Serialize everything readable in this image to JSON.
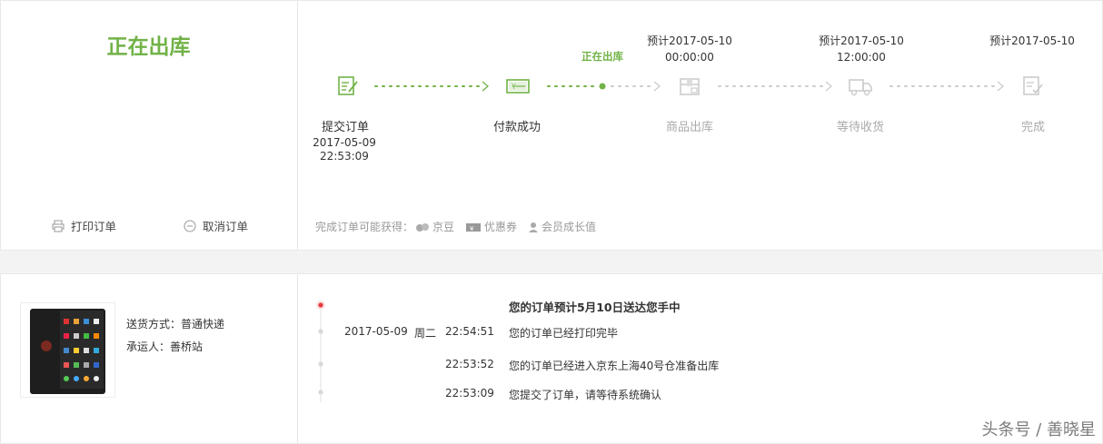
{
  "order_status": {
    "title": "正在出库",
    "actions": [
      {
        "label": "打印订单",
        "icon": "printer-icon"
      },
      {
        "label": "取消订单",
        "icon": "minus-circle-icon"
      }
    ]
  },
  "progress": {
    "current_label": "正在出库",
    "steps": [
      {
        "name": "提交订单",
        "date": "2017-05-09",
        "time": "22:53:09",
        "state": "done",
        "icon": "edit-document-icon"
      },
      {
        "name": "付款成功",
        "date": "",
        "time": "",
        "state": "done",
        "icon": "payment-card-icon"
      },
      {
        "name": "商品出库",
        "eta_date": "预计2017-05-10",
        "eta_time": "00:00:00",
        "state": "pending",
        "icon": "package-box-icon"
      },
      {
        "name": "等待收货",
        "eta_date": "预计2017-05-10",
        "eta_time": "12:00:00",
        "state": "pending",
        "icon": "delivery-truck-icon"
      },
      {
        "name": "完成",
        "eta_date": "预计2017-05-10",
        "state": "pending",
        "icon": "checklist-icon"
      }
    ],
    "colors": {
      "active": "#71b247",
      "inactive": "#cccccc"
    }
  },
  "benefits": {
    "prefix": "完成订单可能获得：",
    "items": [
      {
        "label": "京豆",
        "icon": "bean-icon"
      },
      {
        "label": "优惠券",
        "icon": "coupon-icon"
      },
      {
        "label": "会员成长值",
        "icon": "member-icon"
      }
    ]
  },
  "product": {
    "image_icon": "smartphone-icon",
    "delivery_method": "送货方式：普通快递",
    "carrier": "承运人：善桥站"
  },
  "tracking": {
    "headline": "您的订单预计5月10日送达您手中",
    "events": [
      {
        "date": "2017-05-09",
        "weekday": "周二",
        "time": "22:54:51",
        "message": "您的订单已经打印完毕"
      },
      {
        "date": "",
        "weekday": "",
        "time": "22:53:52",
        "message": "您的订单已经进入京东上海40号仓准备出库"
      },
      {
        "date": "",
        "weekday": "",
        "time": "22:53:09",
        "message": "您提交了订单，请等待系统确认"
      }
    ],
    "active_color": "#e4393c"
  },
  "watermark": "头条号 / 善晓星"
}
